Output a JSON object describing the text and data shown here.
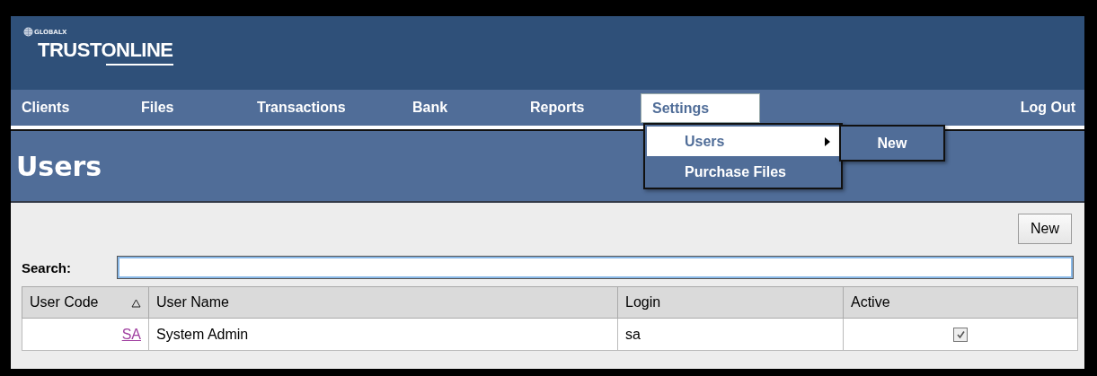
{
  "header": {
    "brand": "GLOBALX",
    "product": "TRUSTONLINE"
  },
  "nav": {
    "items": [
      {
        "label": "Clients",
        "selected": false
      },
      {
        "label": "Files",
        "selected": false
      },
      {
        "label": "Transactions",
        "selected": false
      },
      {
        "label": "Bank",
        "selected": false
      },
      {
        "label": "Reports",
        "selected": false
      },
      {
        "label": "Settings",
        "selected": true
      }
    ],
    "logout": "Log Out"
  },
  "menu": {
    "items": [
      {
        "label": "Users",
        "selected": true,
        "submenu": true
      },
      {
        "label": "Purchase Files",
        "selected": false,
        "submenu": false
      }
    ],
    "submenu_items": [
      "New"
    ]
  },
  "page_title": "Users",
  "new_button": "New",
  "search": {
    "label": "Search:"
  },
  "table": {
    "columns": [
      {
        "label": "User Code",
        "sorted": true
      },
      {
        "label": "User Name",
        "sorted": false
      },
      {
        "label": "Login",
        "sorted": false
      },
      {
        "label": "Active",
        "sorted": false
      }
    ],
    "rows": [
      {
        "code": "SA",
        "name": "System Admin",
        "login": "sa",
        "active": true
      }
    ]
  }
}
